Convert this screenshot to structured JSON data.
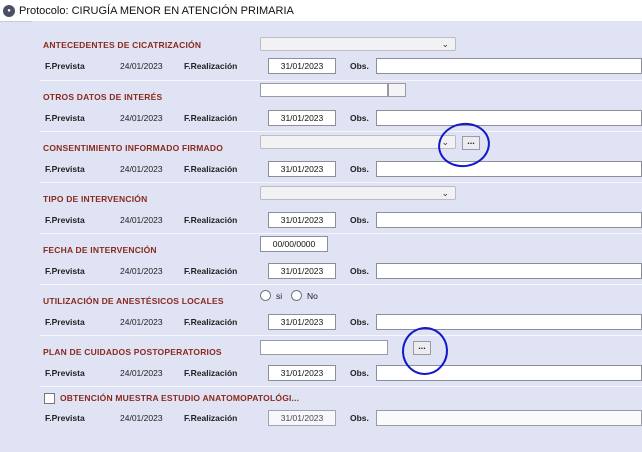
{
  "window": {
    "icon": "app-logo-icon",
    "title": "Protocolo: CIRUGÍA MENOR EN ATENCIÓN PRIMARIA"
  },
  "labels": {
    "fprevista": "F.Prevista",
    "frealizacion": "F.Realización",
    "obs": "Obs."
  },
  "sections": [
    {
      "label": "ANTECEDENTES DE CICATRIZACIÓN",
      "control": "dropdown",
      "fprevista": "24/01/2023",
      "frealizacion": "31/01/2023"
    },
    {
      "label": "OTROS DATOS DE INTERÉS",
      "control": "textbox-ellipsis",
      "fprevista": "24/01/2023",
      "frealizacion": "31/01/2023"
    },
    {
      "label": "CONSENTIMIENTO INFORMADO FIRMADO",
      "control": "dropdown-ellipsis",
      "ellipsis": "...",
      "fprevista": "24/01/2023",
      "frealizacion": "31/01/2023"
    },
    {
      "label": "TIPO DE INTERVENCIÓN",
      "control": "dropdown",
      "fprevista": "24/01/2023",
      "frealizacion": "31/01/2023"
    },
    {
      "label": "FECHA DE INTERVENCIÓN",
      "control": "date",
      "value": "00/00/0000",
      "fprevista": "24/01/2023",
      "frealizacion": "31/01/2023"
    },
    {
      "label": "UTILIZACIÓN DE ANESTÉSICOS LOCALES",
      "control": "radio",
      "options": [
        "si",
        "No"
      ],
      "fprevista": "24/01/2023",
      "frealizacion": "31/01/2023"
    },
    {
      "label": "PLAN DE CUIDADOS POSTOPERATORIOS",
      "control": "textbox-ellipsis",
      "ellipsis": "...",
      "fprevista": "24/01/2023",
      "frealizacion": "31/01/2023"
    },
    {
      "label": "OBTENCIÓN MUESTRA ESTUDIO ANATOMOPATOLÓGI...",
      "control": "checkbox",
      "fprevista": "24/01/2023",
      "frealizacion": "31/01/2023"
    }
  ],
  "colors": {
    "background": "#dfe3f3",
    "section_label": "#8a2a1e",
    "annotation": "#1418c8"
  }
}
